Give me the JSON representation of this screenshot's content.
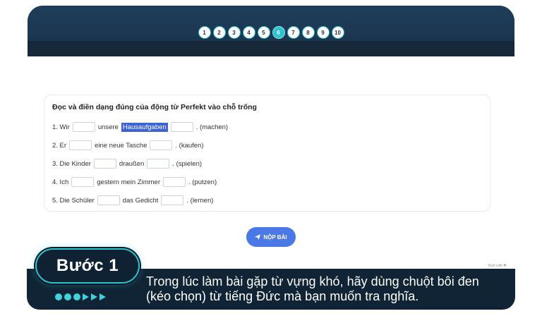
{
  "pager": {
    "pages": [
      "1",
      "2",
      "3",
      "4",
      "5",
      "6",
      "7",
      "8",
      "9",
      "10"
    ],
    "active_index": 5
  },
  "exercise": {
    "instruction": "Đọc và điền dạng đúng của động từ Perfekt vào chỗ trống",
    "rows": [
      {
        "before": "1. Wir",
        "middle_pre": "unsere",
        "highlight": "Hausaufgaben",
        "middle_post": "",
        "after": ". (machen)"
      },
      {
        "before": "2. Er",
        "middle_pre": "eine neue Tasche",
        "highlight": "",
        "middle_post": "",
        "after": ". (kaufen)"
      },
      {
        "before": "3. Die Kinder",
        "middle_pre": "draußen",
        "highlight": "",
        "middle_post": "",
        "after": ". (spielen)"
      },
      {
        "before": "4. Ich",
        "middle_pre": "gestern mein Zimmer",
        "highlight": "",
        "middle_post": "",
        "after": ". (putzen)"
      },
      {
        "before": "5. Die Schüler",
        "middle_pre": "das Gedicht",
        "highlight": "",
        "middle_post": "",
        "after": ". (lernen)"
      }
    ]
  },
  "submit": {
    "label": "NỘP BÀI",
    "icon": "send-icon"
  },
  "credit": "Built with ❤",
  "step": {
    "badge": "Bước 1",
    "caption": "Trong lúc làm bài gặp từ vựng khó, hãy dùng chuột bôi đen (kéo chọn) từ tiếng Đức mà bạn muốn tra nghĩa."
  },
  "colors": {
    "accent": "#2ec4cf",
    "header": "#1b3147",
    "button": "#4a78e6",
    "highlight": "#3d63d6"
  }
}
